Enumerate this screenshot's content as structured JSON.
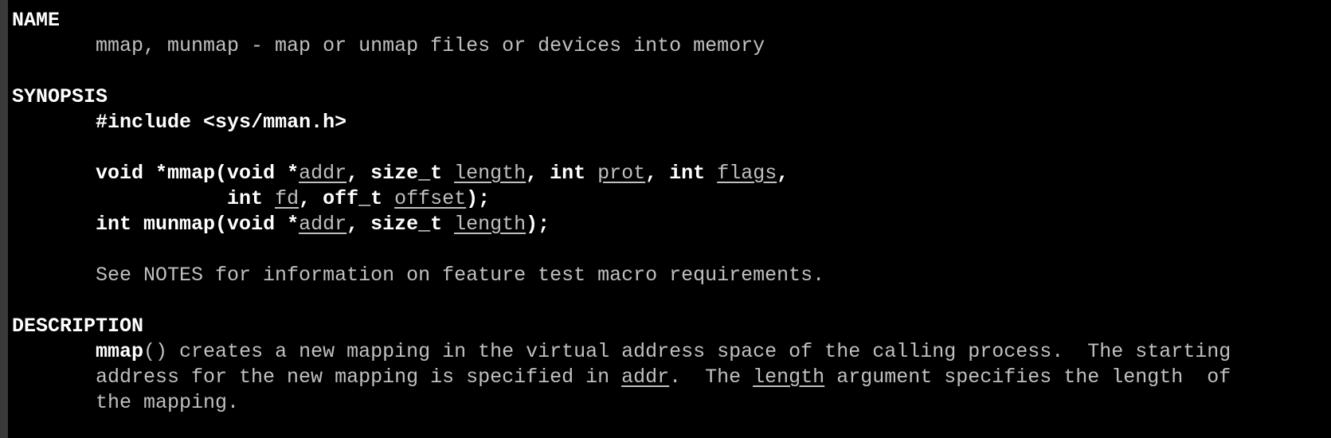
{
  "colors": {
    "background": "#000000",
    "text": "#c0c0c0",
    "bold": "#ffffff"
  },
  "lines": [
    [
      {
        "t": "NAME",
        "s": "b"
      }
    ],
    [
      {
        "t": "       mmap, munmap - map or unmap files or devices into memory",
        "s": "n"
      }
    ],
    [],
    [
      {
        "t": "SYNOPSIS",
        "s": "b"
      }
    ],
    [
      {
        "t": "       ",
        "s": "n"
      },
      {
        "t": "#include <sys/mman.h>",
        "s": "b"
      }
    ],
    [],
    [
      {
        "t": "       ",
        "s": "n"
      },
      {
        "t": "void *mmap(void *",
        "s": "b"
      },
      {
        "t": "addr",
        "s": "u"
      },
      {
        "t": ", size_t ",
        "s": "b"
      },
      {
        "t": "length",
        "s": "u"
      },
      {
        "t": ", int ",
        "s": "b"
      },
      {
        "t": "prot",
        "s": "u"
      },
      {
        "t": ", int ",
        "s": "b"
      },
      {
        "t": "flags",
        "s": "u"
      },
      {
        "t": ",",
        "s": "b"
      }
    ],
    [
      {
        "t": "                  ",
        "s": "n"
      },
      {
        "t": "int ",
        "s": "b"
      },
      {
        "t": "fd",
        "s": "u"
      },
      {
        "t": ", off_t ",
        "s": "b"
      },
      {
        "t": "offset",
        "s": "u"
      },
      {
        "t": ");",
        "s": "b"
      }
    ],
    [
      {
        "t": "       ",
        "s": "n"
      },
      {
        "t": "int munmap(void *",
        "s": "b"
      },
      {
        "t": "addr",
        "s": "u"
      },
      {
        "t": ", size_t ",
        "s": "b"
      },
      {
        "t": "length",
        "s": "u"
      },
      {
        "t": ");",
        "s": "b"
      }
    ],
    [],
    [
      {
        "t": "       See NOTES for information on feature test macro requirements.",
        "s": "n"
      }
    ],
    [],
    [
      {
        "t": "DESCRIPTION",
        "s": "b"
      }
    ],
    [
      {
        "t": "       ",
        "s": "n"
      },
      {
        "t": "mmap",
        "s": "b"
      },
      {
        "t": "() creates a new mapping in the virtual address space of the calling process.  The starting",
        "s": "n"
      }
    ],
    [
      {
        "t": "       address for the new mapping is specified in ",
        "s": "n"
      },
      {
        "t": "addr",
        "s": "u"
      },
      {
        "t": ".  The ",
        "s": "n"
      },
      {
        "t": "length",
        "s": "u"
      },
      {
        "t": " argument specifies the length  of",
        "s": "n"
      }
    ],
    [
      {
        "t": "       the mapping.",
        "s": "n"
      }
    ]
  ]
}
